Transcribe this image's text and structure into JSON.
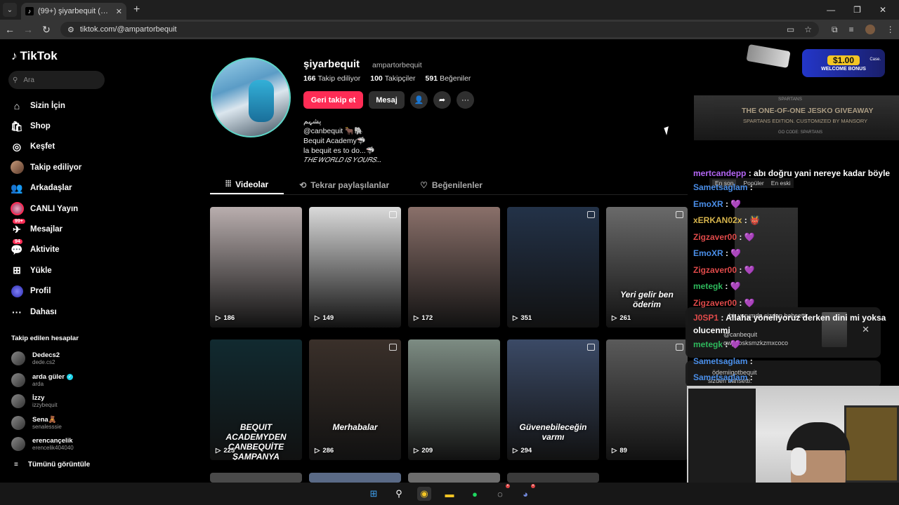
{
  "browser": {
    "tab_title": "(99+) şiyarbequit (@ampartorbe",
    "url": "tiktok.com/@ampartorbequit"
  },
  "sidebar": {
    "logo": "TikTok",
    "search_placeholder": "Ara",
    "nav": [
      {
        "label": "Sizin İçin",
        "icon": "home-icon"
      },
      {
        "label": "Shop",
        "icon": "shop-icon"
      },
      {
        "label": "Keşfet",
        "icon": "compass-icon"
      },
      {
        "label": "Takip ediliyor",
        "icon": "following-avatar-icon"
      },
      {
        "label": "Arkadaşlar",
        "icon": "friends-icon"
      },
      {
        "label": "CANLI Yayın",
        "icon": "live-icon"
      },
      {
        "label": "Mesajlar",
        "icon": "messages-icon",
        "badge": "99+"
      },
      {
        "label": "Aktivite",
        "icon": "activity-icon",
        "badge": "94"
      },
      {
        "label": "Yükle",
        "icon": "upload-icon"
      },
      {
        "label": "Profil",
        "icon": "profile-icon"
      },
      {
        "label": "Dahası",
        "icon": "more-icon"
      }
    ],
    "following_title": "Takip edilen hesaplar",
    "following": [
      {
        "name": "Dedecs2",
        "handle": "dede.cs2"
      },
      {
        "name": "arda güler",
        "handle": "arda",
        "verified": true
      },
      {
        "name": "İzzy",
        "handle": "izzybequit"
      },
      {
        "name": "Sena🧸",
        "handle": "senalesssie"
      },
      {
        "name": "erencançelik",
        "handle": "erencelik404040"
      }
    ],
    "see_all": "Tümünü görüntüle"
  },
  "profile": {
    "name": "şiyarbequit",
    "handle": "ampartorbequit",
    "stats": [
      {
        "value": "166",
        "label": "Takip ediliyor"
      },
      {
        "value": "100",
        "label": "Takipçiler"
      },
      {
        "value": "591",
        "label": "Beğeniler"
      }
    ],
    "follow_back": "Geri takip et",
    "message": "Mesaj",
    "bio": [
      "پشہم",
      "@canbequit 🐂🐘",
      "Bequit Academy🦈",
      "la bequit es to do...🦈",
      "𝑇𝐻𝐸 𝑊𝑂𝑅𝐿𝐷 𝐼𝑆 𝑌𝑂𝑈𝑅𝑆..."
    ],
    "tabs": [
      "Videolar",
      "Tekrar paylaşılanlar",
      "Beğenilenler"
    ]
  },
  "videos": [
    {
      "views": "186",
      "bg": "#b9aeae",
      "caption": ""
    },
    {
      "views": "149",
      "bg": "#dadada",
      "caption": "",
      "pinned": true
    },
    {
      "views": "172",
      "bg": "#8a706a",
      "caption": ""
    },
    {
      "views": "351",
      "bg": "#233248",
      "caption": "",
      "pinned": true
    },
    {
      "views": "261",
      "bg": "#6a6a6a",
      "caption": "Yeri gelir ben öderim",
      "pinned": true
    },
    {
      "views": "225",
      "bg": "#112a30",
      "caption": "BEQUIT ACADEMYDEN CANBEQUİTE ŞAMPANYA"
    },
    {
      "views": "286",
      "bg": "#3a302a",
      "caption": "Merhabalar",
      "pinned": true
    },
    {
      "views": "209",
      "bg": "#7d8c83",
      "caption": ""
    },
    {
      "views": "294",
      "bg": "#3b4a66",
      "caption": "Güvenebileceğin varmı",
      "pinned": true
    },
    {
      "views": "89",
      "bg": "#5a5a5a",
      "caption": "",
      "pinned": true
    }
  ],
  "overlay": {
    "banner_amount": "$1.00",
    "banner_text": "WELCOME BONUS",
    "banner_brand": "Case.",
    "promo_top": "SPARTANS",
    "promo_title": "THE ONE-OF-ONE JESKO GIVEAWAY",
    "promo_sub": "SPARTANS EDITION. CUSTOMIZED BY MANSORY",
    "promo_bottom": "GO CODE: SPARTANS",
    "filter_tabs": [
      "En son",
      "Popüler",
      "En eski"
    ],
    "chat": [
      {
        "user": "mertcandepp",
        "text": "abı doğru yani nereye kadar böyle",
        "color": "#b466f5"
      },
      {
        "user": "Sametsaglam",
        "text": "",
        "color": "#4a8ee8"
      },
      {
        "user": "EmoXR",
        "text": "💜",
        "color": "#4a8ee8"
      },
      {
        "user": "xERKAN02x",
        "text": "👹",
        "color": "#d6b44c"
      },
      {
        "user": "Zigzaver00",
        "text": "💜",
        "color": "#e04a4a"
      },
      {
        "user": "EmoXR",
        "text": "💜",
        "color": "#4a8ee8"
      },
      {
        "user": "Zigzaver00",
        "text": "💜",
        "color": "#e04a4a"
      },
      {
        "user": "metegk",
        "text": "💜",
        "color": "#2eb85c"
      },
      {
        "user": "Zigzaver00",
        "text": "💜",
        "color": "#e04a4a"
      },
      {
        "user": "J0SP1",
        "text": "Allaha yöneliyoruz derken dini mi yoksa olucenmi",
        "color": "#e04a4a"
      },
      {
        "user": "metegk",
        "text": "💜",
        "color": "#2eb85c"
      },
      {
        "user": "Sametsaglam",
        "text": "",
        "color": "#4a8ee8"
      },
      {
        "user": "Sametsaglam",
        "text": "",
        "color": "#4a8ee8"
      }
    ],
    "notif1": "bir yorumda sizden bahsetti:",
    "notif1_user": "@canbequit",
    "notif1_text": "qwpeosksmzkzmxcoco",
    "notif2_user": "ödemiigotbequit",
    "notif2": "sizden bahsetti:"
  }
}
